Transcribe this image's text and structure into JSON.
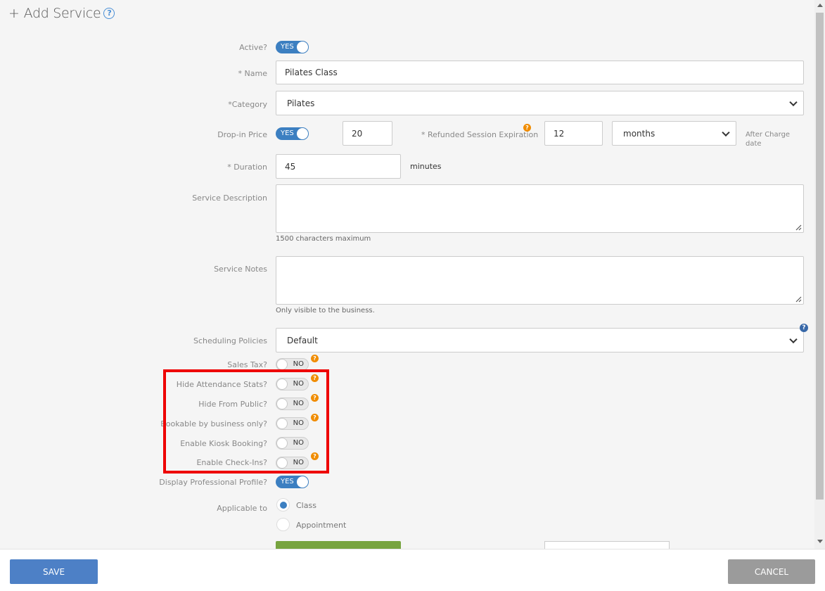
{
  "header": {
    "plus": "+",
    "title": "Add Service",
    "help": "?"
  },
  "form": {
    "active": {
      "label": "Active?",
      "value": "YES"
    },
    "name": {
      "label": "* Name",
      "value": "Pilates Class"
    },
    "category": {
      "label": "*Category",
      "value": "Pilates"
    },
    "dropin": {
      "label": "Drop-in Price",
      "toggle": "YES",
      "price": "20"
    },
    "refund": {
      "label": "* Refunded Session Expiration",
      "help": "?",
      "value": "12",
      "unit": "months",
      "after": "After Charge date"
    },
    "duration": {
      "label": "* Duration",
      "value": "45",
      "unit": "minutes"
    },
    "description": {
      "label": "Service Description",
      "hint": "1500 characters maximum"
    },
    "notes": {
      "label": "Service Notes",
      "hint": "Only visible to the business."
    },
    "scheduling": {
      "label": "Scheduling Policies",
      "value": "Default",
      "help": "?"
    },
    "sales_tax": {
      "label": "Sales Tax?",
      "value": "NO",
      "help": "?"
    },
    "hide_stats": {
      "label": "Hide Attendance Stats?",
      "value": "NO",
      "help": "?"
    },
    "hide_public": {
      "label": "Hide From Public?",
      "value": "NO",
      "help": "?"
    },
    "bookable": {
      "label": "Bookable by business only?",
      "value": "NO",
      "help": "?"
    },
    "kiosk": {
      "label": "Enable Kiosk Booking?",
      "value": "NO"
    },
    "checkins": {
      "label": "Enable Check-Ins?",
      "value": "NO",
      "help": "?"
    },
    "display_prof": {
      "label": "Display Professional Profile?",
      "value": "YES"
    },
    "applicable": {
      "label": "Applicable to",
      "options": [
        "Class",
        "Appointment"
      ],
      "selected": "Class"
    }
  },
  "footer": {
    "save": "SAVE",
    "cancel": "CANCEL"
  },
  "colors": {
    "accent": "#3c7fc1",
    "save": "#4d80c6",
    "cancel": "#9b9b9b",
    "highlight": "#ee0000",
    "help_orange": "#f08c00",
    "green": "#77a43f"
  },
  "icons": [
    "help-circle-icon",
    "chevron-down-icon",
    "resize-grip-icon",
    "orange-help-icon",
    "blue-help-icon"
  ]
}
